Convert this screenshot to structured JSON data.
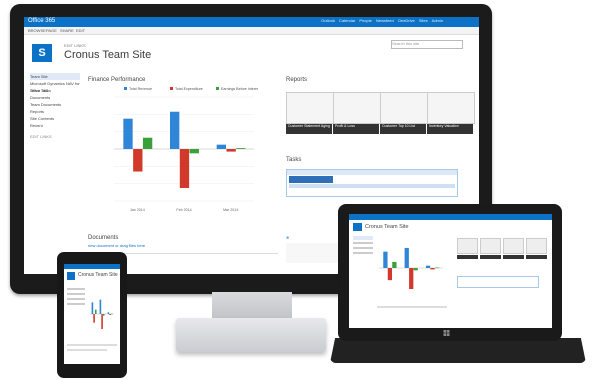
{
  "monitor": {
    "app_name": "Office 365",
    "top_links": [
      "Outlook",
      "Calendar",
      "People",
      "Newsfeed",
      "OneDrive",
      "Sites",
      "Admin"
    ],
    "ribbon_tabs": [
      "BROWSE",
      "PAGE",
      "SHARE",
      "EDIT"
    ],
    "search_placeholder": "Search this site",
    "edit_links": "EDIT LINKS",
    "site_title": "Cronus Team Site",
    "nav_items": [
      "Team Site",
      "Microsoft Dynamics NAV for Office 365",
      "Team Tasks",
      "Documents",
      "Team Documents",
      "Reports",
      "Site Contents",
      "Recent"
    ],
    "nav_edit": "EDIT LINKS",
    "finance_title": "Finance Performance",
    "reports_title": "Reports",
    "tasks_title": "Tasks",
    "documents_title": "Documents",
    "documents_actions": "new document  or drag files here",
    "reports": [
      "Customer Statement Aging",
      "Profit & Loss",
      "Customer Top 10 List",
      "Inventory Valuation"
    ],
    "colors": {
      "blue": "#2f86d6",
      "red": "#d13a2b",
      "green": "#3aa03a",
      "topbar": "#0b72c6"
    }
  },
  "tablet": {
    "site_title": "Cronus Team Site"
  },
  "phone": {
    "site_title": "Cronus Team Site"
  },
  "chart_data": [
    {
      "type": "bar",
      "title": "Finance Performance",
      "categories": [
        "Jan 2014",
        "Feb 2014",
        "Mar 2014"
      ],
      "series": [
        {
          "name": "Total Revenue",
          "values": [
            3500000,
            4300000,
            500000
          ]
        },
        {
          "name": "Total Expenditure",
          "values": [
            -2600000,
            -4500000,
            -300000
          ]
        },
        {
          "name": "Earnings Before Interest",
          "values": [
            1300000,
            -500000,
            100000
          ]
        }
      ],
      "ylim": [
        -6000000,
        6000000
      ],
      "grid": true,
      "legend_position": "top"
    }
  ]
}
